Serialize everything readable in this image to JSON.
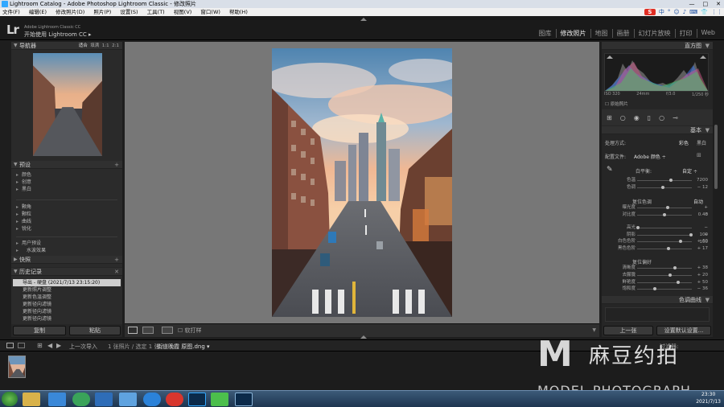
{
  "window": {
    "title": "Lightroom Catalog - Adobe Photoshop Lightroom Classic - 修改照片",
    "controls": [
      "—",
      "□",
      "✕"
    ]
  },
  "menu": [
    "文件(F)",
    "编辑(E)",
    "修改照片(D)",
    "照片(P)",
    "设置(S)",
    "工具(T)",
    "视图(V)",
    "窗口(W)",
    "帮助(H)"
  ],
  "tray_ime": {
    "badge": "S",
    "items": [
      "中",
      "°",
      "☺",
      "♪",
      "⌨",
      "👕",
      "⋮⋮"
    ]
  },
  "identity": {
    "logo": "Lr",
    "line1": "Adobe Lightroom Classic CC",
    "line2": "开始使用 Lightroom CC",
    "arrow": "▸"
  },
  "modules": [
    {
      "label": "图库"
    },
    {
      "label": "修改照片",
      "active": true
    },
    {
      "label": "地图"
    },
    {
      "label": "画册"
    },
    {
      "label": "幻灯片放映"
    },
    {
      "label": "打印"
    },
    {
      "label": "Web"
    }
  ],
  "navigator": {
    "title": "导航器",
    "zoom": [
      "适合",
      "填满",
      "1:1",
      "2:1"
    ]
  },
  "presets": {
    "title": "预设",
    "add": "+",
    "groups1": [
      "颜色",
      "创意",
      "黑白"
    ],
    "groups2": [
      "颗角",
      "颗粒",
      "曲线",
      "锐化"
    ],
    "user_group": "用户预设",
    "user_item": "水波效果"
  },
  "snapshots": {
    "title": "快照",
    "add": "+"
  },
  "history": {
    "title": "历史记录",
    "close": "✕",
    "items": [
      "导出 - 硬盘 (2021/7/13 23:15:20)",
      "更新照片调整",
      "更新色温调整",
      "更新径向滤镜",
      "更新径向滤镜",
      "更新径向滤镜"
    ]
  },
  "left_buttons": {
    "copy": "复制",
    "paste": "粘贴"
  },
  "histogram": {
    "title": "直方图",
    "iso": "ISO 320",
    "focal": "24mm",
    "aperture": "f/3.0",
    "shutter": "1/250 秒",
    "original": "原始照片"
  },
  "basic": {
    "title": "基本",
    "treatment_label": "处理方式:",
    "treatment_color": "彩色",
    "treatment_bw": "黑白",
    "profile_label": "配置文件:",
    "profile_value": "Adobe 颜色 ÷",
    "wb_label": "白平衡:",
    "wb_value": "自定 ÷",
    "temp": {
      "label": "色温",
      "value": "7200",
      "fraction": 0.62
    },
    "tint": {
      "label": "色调",
      "value": "− 12",
      "fraction": 0.47
    },
    "tone_label": "复位色调",
    "auto": "自动",
    "exposure": {
      "label": "曝光度",
      "value": "+ 0.48",
      "fraction": 0.56
    },
    "contrast": {
      "label": "对比度",
      "value": "0",
      "fraction": 0.5
    },
    "highlights": {
      "label": "高光",
      "value": "− 100",
      "fraction": 0.02
    },
    "shadows": {
      "label": "阴影",
      "value": "+ 100",
      "fraction": 0.98
    },
    "whites": {
      "label": "白色色阶",
      "value": "+ 60",
      "fraction": 0.8
    },
    "blacks": {
      "label": "黑色色阶",
      "value": "+ 17",
      "fraction": 0.58
    },
    "presence_label": "复位偏好",
    "texture": {
      "label": "清晰度",
      "value": "+ 38",
      "fraction": 0.69
    },
    "clarity": {
      "label": "去朦胧",
      "value": "+ 20",
      "fraction": 0.6
    },
    "vibrance": {
      "label": "鲜艳度",
      "value": "+ 50",
      "fraction": 0.75
    },
    "saturation": {
      "label": "饱和度",
      "value": "− 36",
      "fraction": 0.32
    }
  },
  "tone_curve": {
    "title": "色调曲线"
  },
  "right_buttons": {
    "prev": "上一张",
    "reset": "设置默认设置..."
  },
  "toolbar": {
    "softproof": "软打样"
  },
  "filmstrip": {
    "source": "上一次导入",
    "count": "1 张照片 / 选定 1 张 /",
    "filename": "街道晚霞 原图.dng ▾",
    "filter": "过滤器:"
  },
  "watermark": {
    "letter": "M",
    "cn": "麻豆约拍",
    "en": "MODEL PHOTOGRAPH"
  },
  "clock": {
    "time": "23:30",
    "date": "2021/7/13"
  },
  "taskbar_apps": [
    "start-orb",
    "explorer",
    "media",
    "360",
    "player",
    "cloud",
    "ie",
    "netease",
    "ps",
    "wechat",
    "lr"
  ]
}
